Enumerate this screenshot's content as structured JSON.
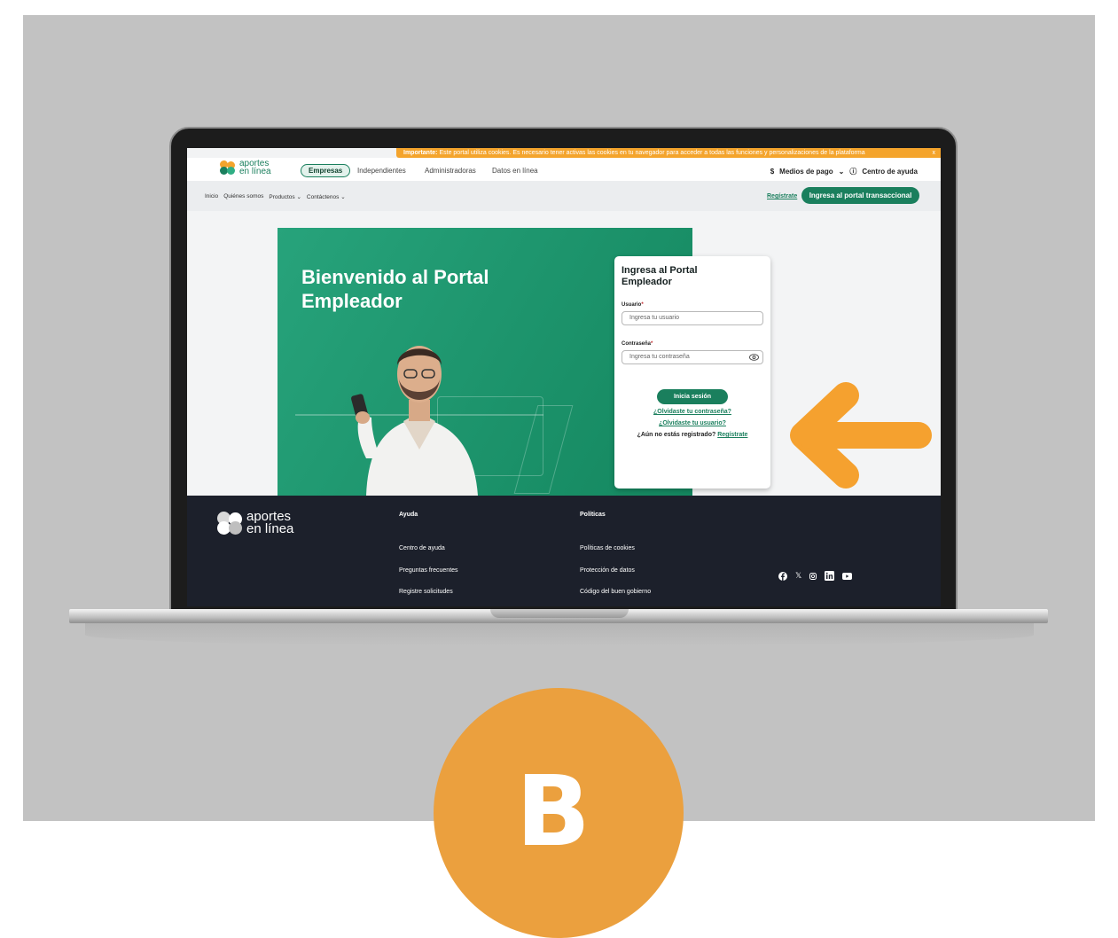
{
  "cookie_banner": {
    "strong": "Importante:",
    "text": "Este portal utiliza cookies. Es necesario tener activas las cookies en tu navegador para acceder a todas las funciones y personalizaciones de la plataforma",
    "close": "x"
  },
  "brand": {
    "line1": "aportes",
    "line2": "en línea",
    "colors": {
      "orange": "#f4a42c",
      "green": "#1a7f5d",
      "teal": "#2fae84"
    }
  },
  "top_nav": {
    "empresas": "Empresas",
    "independientes": "Independientes",
    "administradoras": "Administradoras",
    "datos": "Datos en línea",
    "medios": "Medios de pago",
    "ayuda": "Centro de ayuda"
  },
  "secondary_nav": {
    "inicio": "Inicio",
    "quienes": "Quiénes somos",
    "productos": "Productos",
    "contactenos": "Contáctenos",
    "registrate": "Regístrate",
    "portal_button": "Ingresa al portal transaccional"
  },
  "hero": {
    "title": "Bienvenido al Portal Empleador"
  },
  "login": {
    "title": "Ingresa al Portal Empleador",
    "user_label": "Usuario",
    "user_placeholder": "Ingresa tu usuario",
    "pass_label": "Contraseña",
    "pass_placeholder": "Ingresa tu contraseña",
    "signin": "Inicia sesión",
    "forgot_pass": "¿Olvidaste tu contraseña?",
    "forgot_user": "¿Olvidaste tu usuario?",
    "no_account": "¿Aún no estás registrado?",
    "register": "Regístrate"
  },
  "footer": {
    "ayuda_title": "Ayuda",
    "ayuda_items": [
      "Centro de ayuda",
      "Preguntas frecuentes",
      "Registre solicitudes"
    ],
    "politicas_title": "Políticas",
    "politicas_items": [
      "Políticas de cookies",
      "Protección de datos",
      "Código del buen gobierno"
    ],
    "social_icons": [
      "facebook-icon",
      "x-icon",
      "instagram-icon",
      "linkedin-icon",
      "youtube-icon"
    ]
  },
  "step_badge": {
    "letter": "B",
    "color": "#eba03e"
  },
  "arrow": {
    "color": "#f5a12f"
  }
}
